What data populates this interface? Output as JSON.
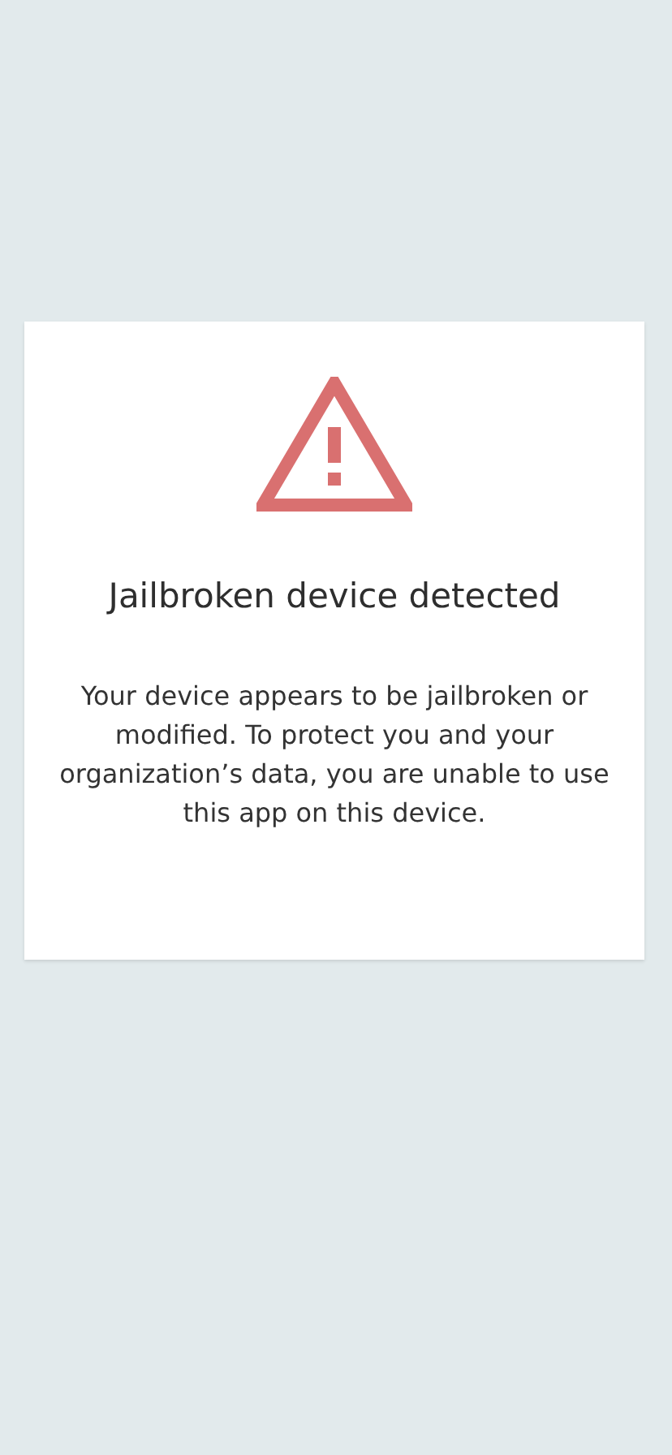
{
  "alert": {
    "title": "Jailbroken device detected",
    "message": "Your device appears to be jailbroken or modified. To protect you and your organization’s data, you are unable to use this app on this device."
  }
}
